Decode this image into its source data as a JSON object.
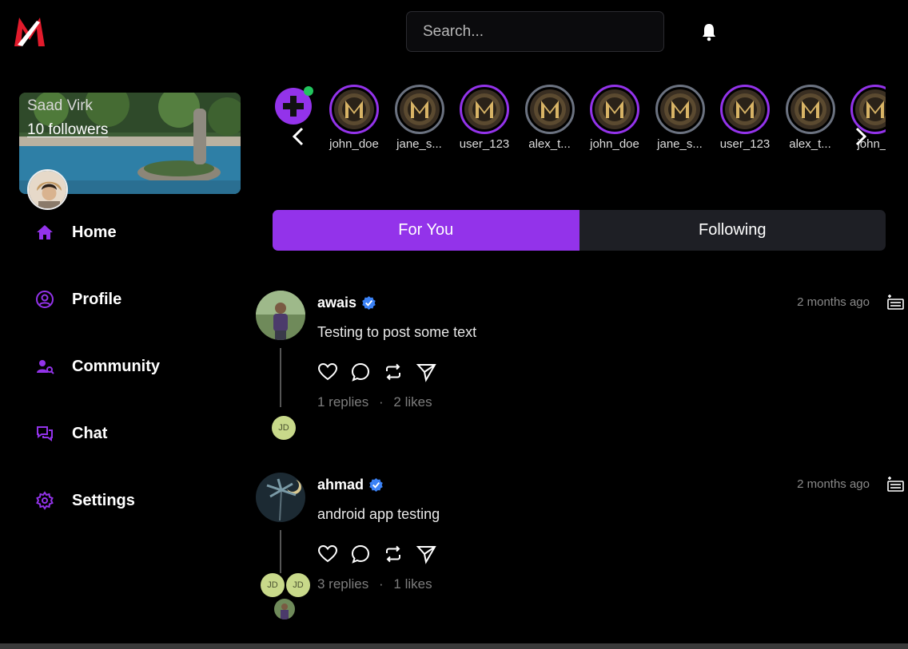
{
  "header": {
    "search_placeholder": "Search..."
  },
  "profile_card": {
    "name": "Saad Virk",
    "followers": "10 followers"
  },
  "nav": {
    "items": [
      {
        "label": "Home",
        "icon": "home-icon"
      },
      {
        "label": "Profile",
        "icon": "user-circle-icon"
      },
      {
        "label": "Community",
        "icon": "user-search-icon"
      },
      {
        "label": "Chat",
        "icon": "chat-bubbles-icon"
      },
      {
        "label": "Settings",
        "icon": "gear-icon"
      }
    ]
  },
  "stories": {
    "items": [
      {
        "username": "john_doe",
        "state": "active"
      },
      {
        "username": "jane_s...",
        "state": "seen"
      },
      {
        "username": "user_123",
        "state": "active"
      },
      {
        "username": "alex_t...",
        "state": "seen"
      },
      {
        "username": "john_doe",
        "state": "active"
      },
      {
        "username": "jane_s...",
        "state": "seen"
      },
      {
        "username": "user_123",
        "state": "active"
      },
      {
        "username": "alex_t...",
        "state": "seen"
      },
      {
        "username": "john_d",
        "state": "active"
      }
    ]
  },
  "tabs": {
    "for_you": "For You",
    "following": "Following"
  },
  "posts": [
    {
      "author": "awais",
      "time": "2 months ago",
      "text": "Testing to post some text",
      "replies": "1 replies",
      "separator": "·",
      "likes": "2 likes",
      "reply_avatars": [
        "JD"
      ]
    },
    {
      "author": "ahmad",
      "time": "2 months ago",
      "text": "android app testing",
      "replies": "3 replies",
      "separator": "·",
      "likes": "1 likes",
      "reply_avatars": [
        "JD",
        "JD"
      ]
    }
  ],
  "colors": {
    "accent": "#9333ea",
    "background": "#000000",
    "tab_inactive": "#1e1f25",
    "verified": "#3b82f6",
    "muted_text": "#7d7d7d"
  }
}
